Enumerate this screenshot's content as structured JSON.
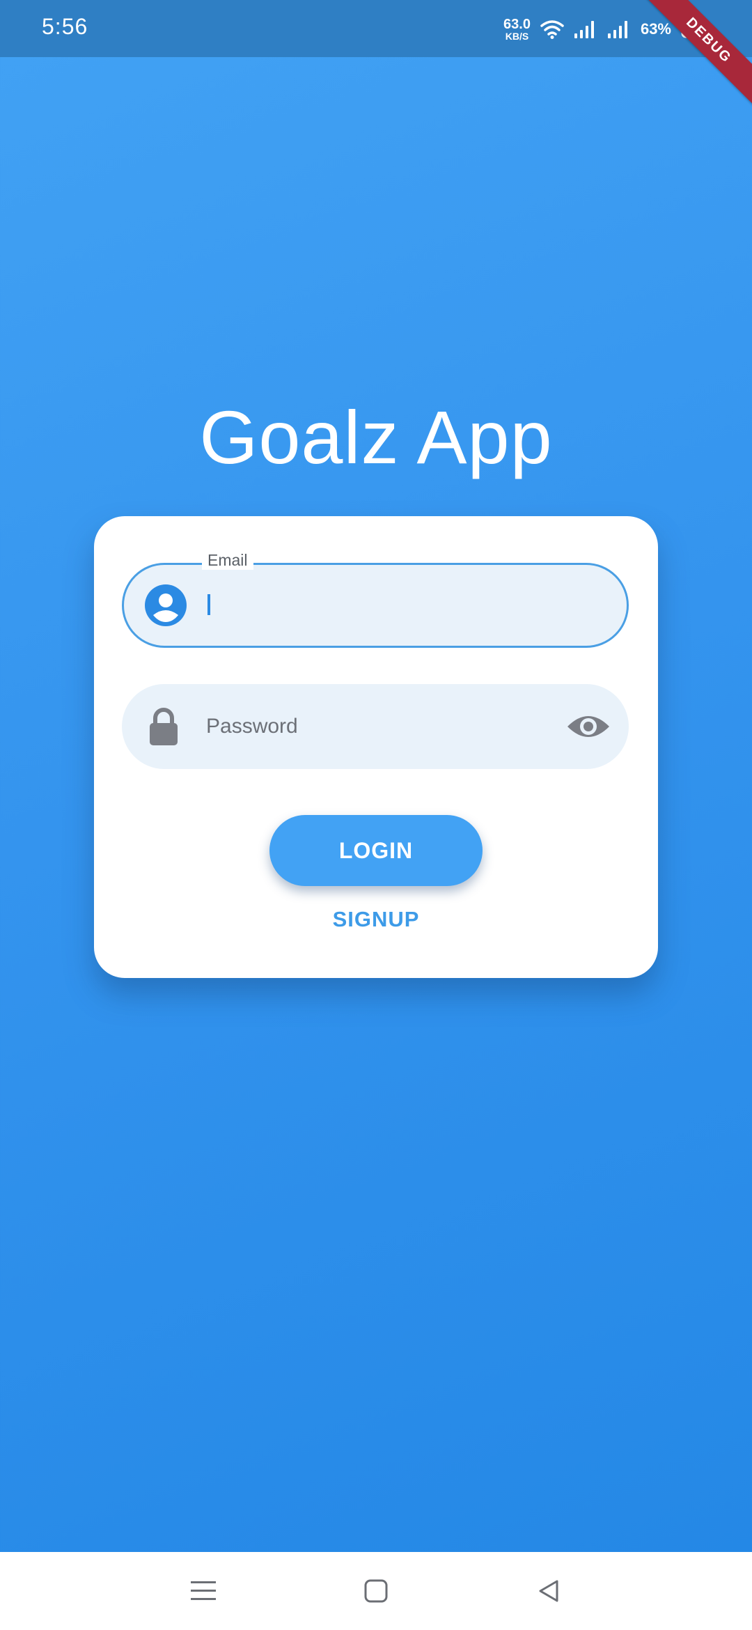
{
  "status_bar": {
    "time": "5:56",
    "net_speed_value": "63.0",
    "net_speed_unit": "KB/S",
    "battery_percent": "63%",
    "icons": [
      "wifi-icon",
      "signal-icon",
      "signal-icon",
      "battery-icon"
    ]
  },
  "debug_banner": "DEBUG",
  "app": {
    "title": "Goalz App"
  },
  "login_form": {
    "email": {
      "label": "Email",
      "value": "",
      "icon": "account-circle-icon"
    },
    "password": {
      "placeholder": "Password",
      "value": "",
      "icon": "lock-icon",
      "toggle_icon": "eye-icon"
    },
    "login_label": "LOGIN",
    "signup_label": "SIGNUP"
  },
  "nav_bar": {
    "items": [
      "menu-icon",
      "home-square-icon",
      "back-triangle-icon"
    ]
  },
  "colors": {
    "background_top": "#42a2f4",
    "background_bottom": "#2387e5",
    "status_bar": "#2f7fc4",
    "accent": "#42a2f4",
    "field_fill": "#e9f2fa",
    "debug_banner": "#a8283a"
  }
}
